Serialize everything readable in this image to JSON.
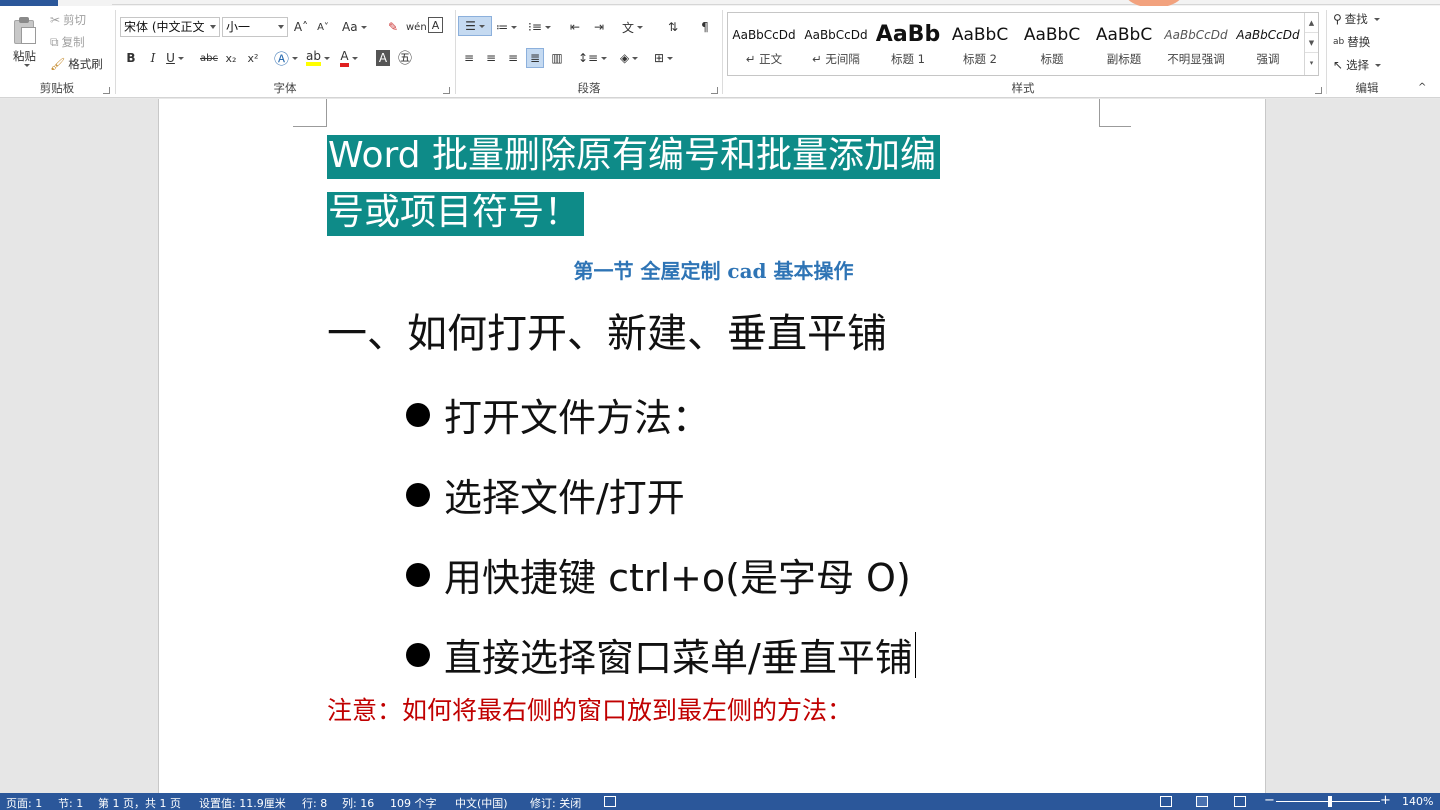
{
  "clipboard": {
    "paste_label": "粘贴",
    "cut_label": "剪切",
    "copy_label": "复制",
    "format_painter_label": "格式刷",
    "group_label": "剪贴板"
  },
  "font": {
    "font_name": "宋体 (中文正文",
    "font_size": "小一",
    "grow_icon": "A˄",
    "shrink_icon": "A˅",
    "case_label": "Aa",
    "bold": "B",
    "italic": "I",
    "underline": "U",
    "strike": "abc",
    "subscript": "x₂",
    "superscript": "x²",
    "group_label": "字体"
  },
  "paragraph": {
    "group_label": "段落"
  },
  "styles": {
    "group_label": "样式",
    "items": [
      {
        "sample": "AaBbCcDd",
        "name": "↵ 正文"
      },
      {
        "sample": "AaBbCcDd",
        "name": "↵ 无间隔"
      },
      {
        "sample": "AaBb",
        "name": "标题 1"
      },
      {
        "sample": "AaBbC",
        "name": "标题 2"
      },
      {
        "sample": "AaBbC",
        "name": "标题"
      },
      {
        "sample": "AaBbC",
        "name": "副标题"
      },
      {
        "sample": "AaBbCcDd",
        "name": "不明显强调"
      },
      {
        "sample": "AaBbCcDd",
        "name": "强调"
      }
    ]
  },
  "editing": {
    "find_label": "查找",
    "replace_label": "替换",
    "select_label": "选择",
    "group_label": "编辑"
  },
  "document": {
    "title_line1": "Word  批量删除原有编号和批量添加编",
    "title_line2": "号或项目符号！",
    "subtitle": "第一节  全屋定制 cad 基本操作",
    "heading": "一、如何打开、新建、垂直平铺",
    "bullets": [
      "打开文件方法：",
      "选择文件/打开",
      "用快捷键 ctrl+o(是字母 O)",
      "直接选择窗口菜单/垂直平铺"
    ],
    "note": "注意：如何将最右侧的窗口放到最左侧的方法：",
    "colors": {
      "title_bg": "#0e8b88",
      "subtitle": "#2e74b5",
      "note": "#c00000"
    }
  },
  "status": {
    "page": "页面: 1",
    "section": "节: 1",
    "page_of": "第 1 页，共 1 页",
    "position": "设置值: 11.9厘米",
    "line": "行: 8",
    "column": "列: 16",
    "word_count": "109 个字",
    "language": "中文(中国)",
    "track_changes": "修订: 关闭",
    "zoom": "140%",
    "minus": "−",
    "plus": "+",
    "accent": "#2b579a"
  }
}
